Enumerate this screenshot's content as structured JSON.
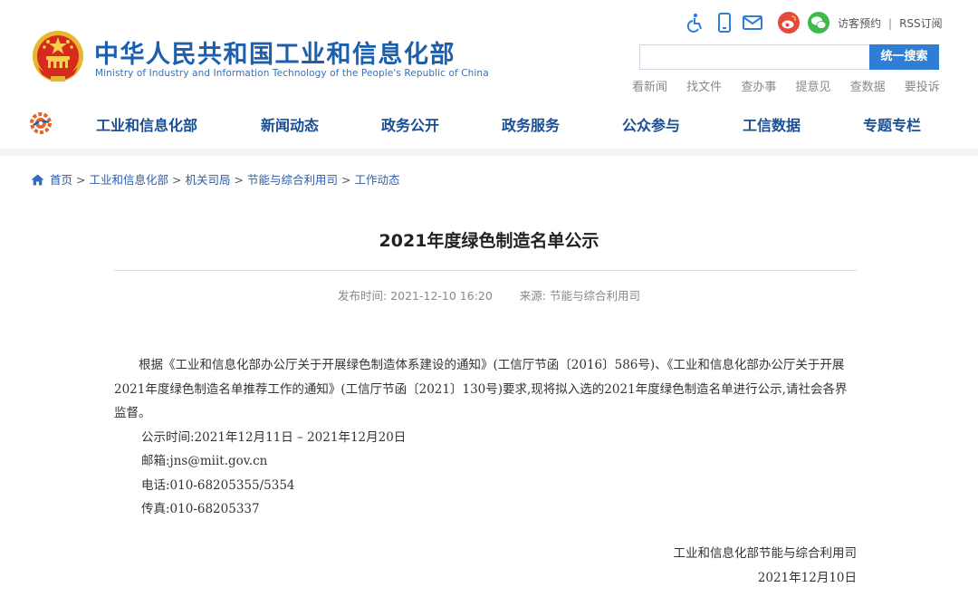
{
  "header": {
    "site_title": "中华人民共和国工业和信息化部",
    "site_subtitle": "Ministry of Industry and Information Technology of the People's Republic of China",
    "top_links": [
      "访客预约",
      "RSS订阅"
    ],
    "search_placeholder": "",
    "search_button": "统一搜索",
    "quick_links": [
      "看新闻",
      "找文件",
      "查办事",
      "提意见",
      "查数据",
      "要投诉"
    ],
    "icons": [
      "accessibility-icon",
      "mobile-icon",
      "mail-icon",
      "weibo-icon",
      "wechat-icon"
    ]
  },
  "nav": {
    "items": [
      "工业和信息化部",
      "新闻动态",
      "政务公开",
      "政务服务",
      "公众参与",
      "工信数据",
      "专题专栏"
    ]
  },
  "breadcrumb": [
    "首页",
    "工业和信息化部",
    "机关司局",
    "节能与综合利用司",
    "工作动态"
  ],
  "article": {
    "title": "2021年度绿色制造名单公示",
    "publish_label": "发布时间:",
    "publish_time": "2021-12-10 16:20",
    "source_label": "来源:",
    "source": "节能与综合利用司",
    "paragraph": "根据《工业和信息化部办公厅关于开展绿色制造体系建设的通知》(工信厅节函〔2016〕586号)、《工业和信息化部办公厅关于开展2021年度绿色制造名单推荐工作的通知》(工信厅节函〔2021〕130号)要求,现将拟入选的2021年度绿色制造名单进行公示,请社会各界监督。",
    "notice_period": "公示时间:2021年12月11日 – 2021年12月20日",
    "email": "邮箱:jns@miit.gov.cn",
    "phone": "电话:010-68205355/5354",
    "fax": "传真:010-68205337",
    "signature": "工业和信息化部节能与综合利用司",
    "date": "2021年12月10日"
  },
  "colors": {
    "brand_blue": "#1b5fad",
    "nav_blue": "#1b4f93",
    "search_button": "#2e7ed6",
    "emblem_red": "#d62a1e",
    "emblem_gold": "#e8b730"
  }
}
